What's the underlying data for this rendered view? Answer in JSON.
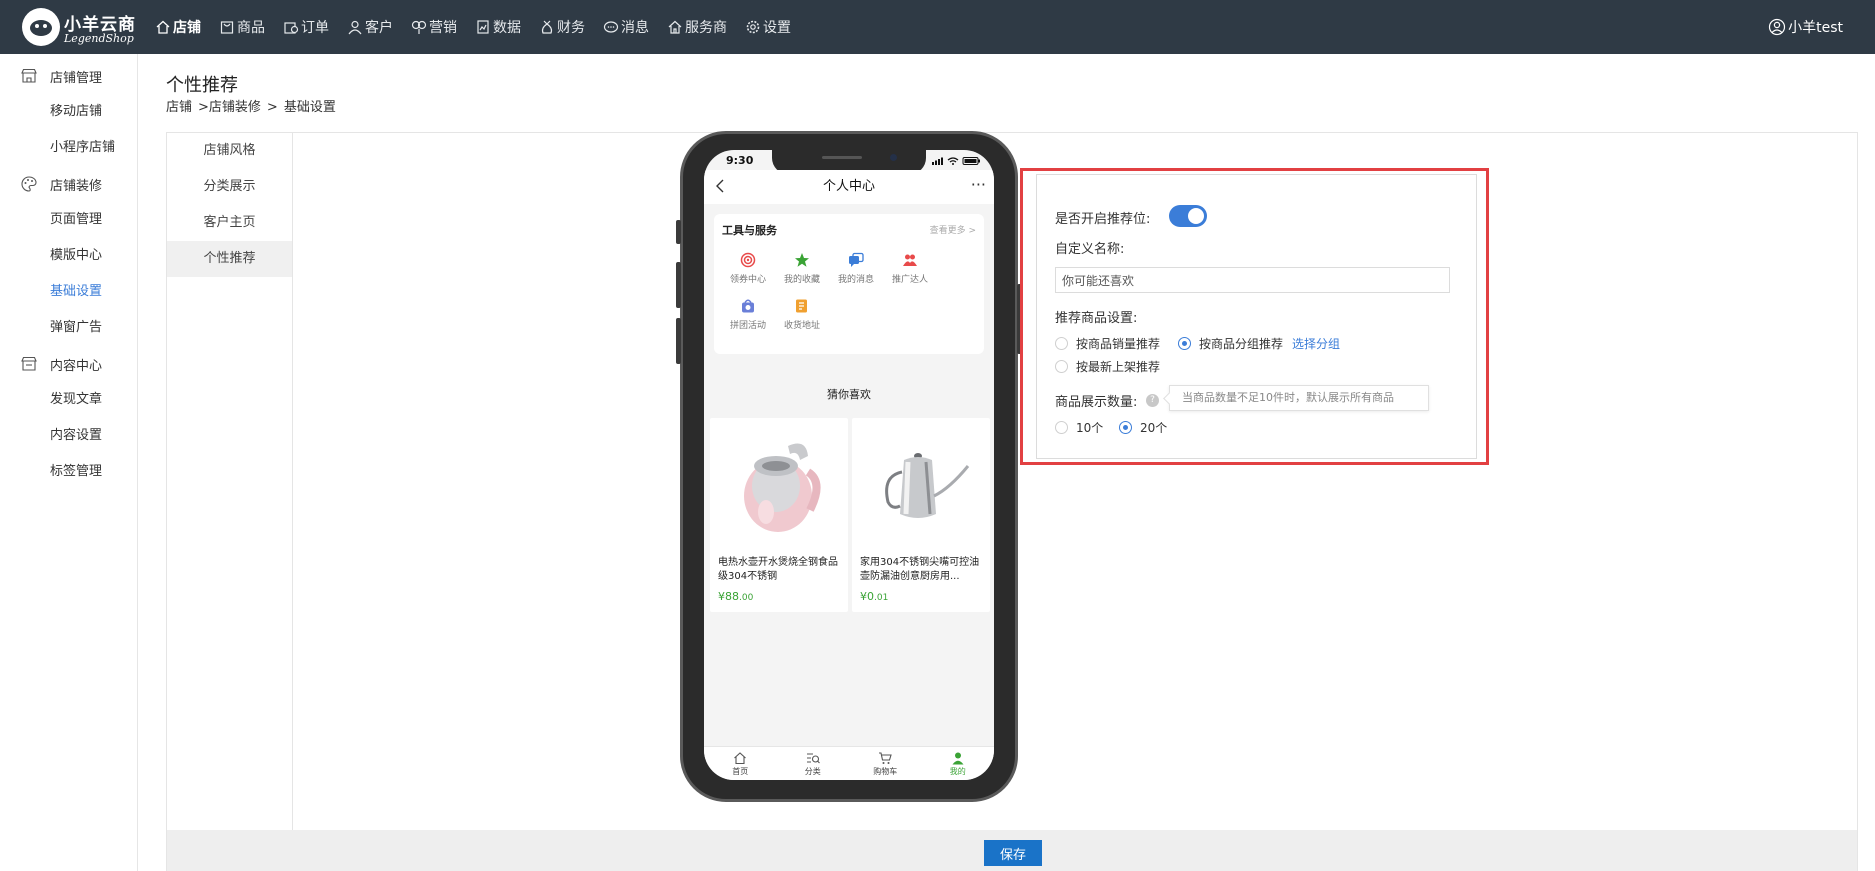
{
  "app": {
    "logo_cn": "小羊云商",
    "logo_en": "LegendShop",
    "user": "小羊test"
  },
  "nav": [
    {
      "label": "店铺",
      "icon": "home-icon",
      "active": true
    },
    {
      "label": "商品",
      "icon": "bag-icon"
    },
    {
      "label": "订单",
      "icon": "order-icon"
    },
    {
      "label": "客户",
      "icon": "user-icon"
    },
    {
      "label": "营销",
      "icon": "marketing-icon"
    },
    {
      "label": "数据",
      "icon": "data-icon"
    },
    {
      "label": "财务",
      "icon": "finance-icon"
    },
    {
      "label": "消息",
      "icon": "message-icon"
    },
    {
      "label": "服务商",
      "icon": "service-icon"
    },
    {
      "label": "设置",
      "icon": "gear-icon"
    }
  ],
  "sidebar": {
    "groups": [
      {
        "label": "店铺管理",
        "icon": "store-icon",
        "items": [
          "移动店铺",
          "小程序店铺"
        ]
      },
      {
        "label": "店铺装修",
        "icon": "palette-icon",
        "items": [
          "页面管理",
          "模版中心",
          "基础设置",
          "弹窗广告"
        ]
      },
      {
        "label": "内容中心",
        "icon": "content-icon",
        "items": [
          "发现文章",
          "内容设置",
          "标签管理"
        ]
      }
    ],
    "active_item": "基础设置"
  },
  "page": {
    "title": "个性推荐",
    "breadcrumb": [
      "店铺",
      ">店铺装修",
      ">",
      "基础设置"
    ]
  },
  "subnav": [
    "店铺风格",
    "分类展示",
    "客户主页",
    "个性推荐"
  ],
  "phone": {
    "time": "9:30",
    "title": "个人中心",
    "more": "···",
    "tools_title": "工具与服务",
    "tools_more": "查看更多 >",
    "tools": [
      {
        "label": "领券中心",
        "color": "#e84a4a"
      },
      {
        "label": "我的收藏",
        "color": "#3aa335"
      },
      {
        "label": "我的消息",
        "color": "#3b7dd8"
      },
      {
        "label": "推广达人",
        "color": "#e84a4a"
      },
      {
        "label": "拼团活动",
        "color": "#6a7fd8"
      },
      {
        "label": "收货地址",
        "color": "#f0a030"
      }
    ],
    "guess_title": "猜你喜欢",
    "products": [
      {
        "name": "电热水壶开水煲烧全钢食品级304不锈钢",
        "price_symbol": "¥",
        "price_int": "88",
        "price_dec": ".00"
      },
      {
        "name": "家用304不锈钢尖嘴可控油壶防漏油创意厨房用...",
        "price_symbol": "¥",
        "price_int": "0",
        "price_dec": ".01"
      }
    ],
    "tabs": [
      {
        "label": "首页",
        "icon": "home-icon"
      },
      {
        "label": "分类",
        "icon": "category-icon"
      },
      {
        "label": "购物车",
        "icon": "cart-icon"
      },
      {
        "label": "我的",
        "icon": "profile-icon",
        "active": true
      }
    ]
  },
  "settings": {
    "enable_label": "是否开启推荐位:",
    "enabled": true,
    "name_label": "自定义名称:",
    "name_value": "你可能还喜欢",
    "rec_label": "推荐商品设置:",
    "rec_options": [
      "按商品销量推荐",
      "按商品分组推荐",
      "按最新上架推荐"
    ],
    "rec_selected": "按商品分组推荐",
    "select_group_link": "选择分组",
    "count_label": "商品展示数量:",
    "help_glyph": "?",
    "count_tooltip": "当商品数量不足10件时，默认展示所有商品",
    "count_options": [
      "10个",
      "20个"
    ],
    "count_selected": "20个"
  },
  "footer": {
    "save_label": "保存"
  },
  "colors": {
    "topbar": "#2f3a45",
    "accent": "#3b7dd8",
    "highlight_border": "#e24042",
    "price_green": "#3aa335",
    "save_button": "#1a73c8"
  }
}
